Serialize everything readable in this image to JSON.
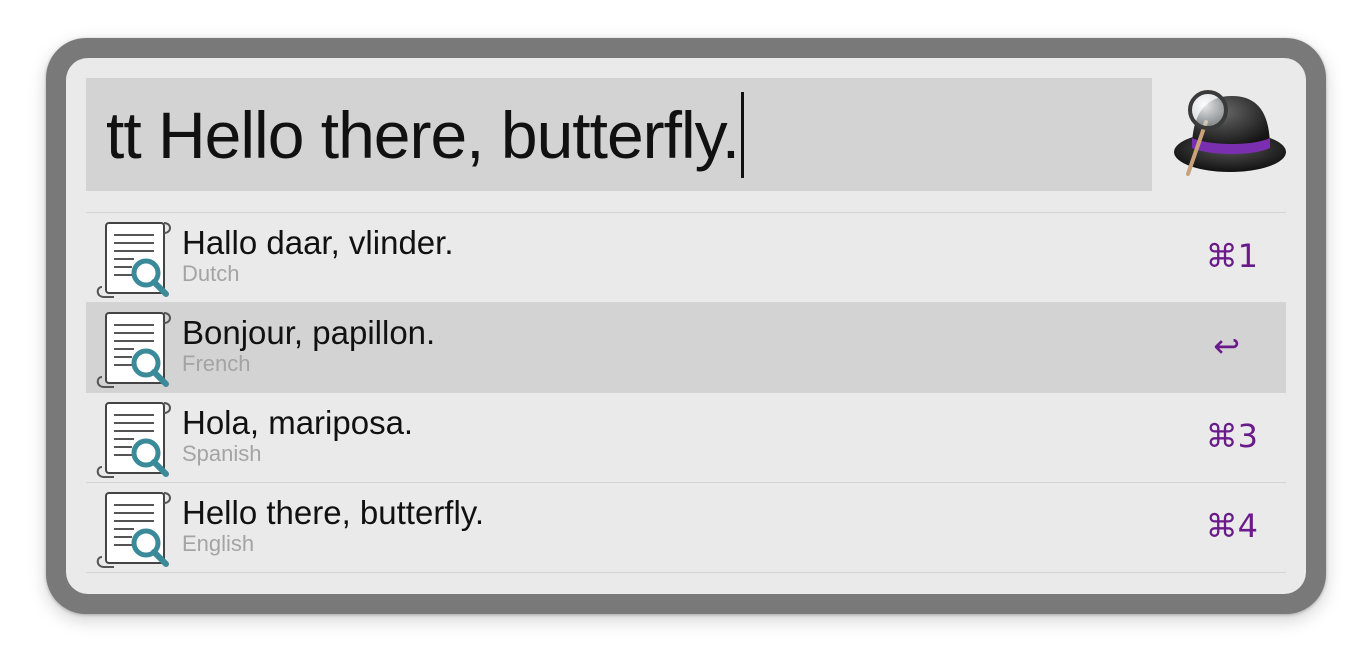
{
  "search": {
    "query": "tt Hello there, butterfly."
  },
  "app_icon": "alfred-hat-icon",
  "accent_color": "#6a1b8a",
  "results": [
    {
      "title": "Hallo daar, vlinder.",
      "subtitle": "Dutch",
      "shortcut": "⌘1",
      "icon": "document-search-icon",
      "selected": false
    },
    {
      "title": "Bonjour, papillon.",
      "subtitle": "French",
      "shortcut": "↩",
      "icon": "document-search-icon",
      "selected": true
    },
    {
      "title": "Hola, mariposa.",
      "subtitle": "Spanish",
      "shortcut": "⌘3",
      "icon": "document-search-icon",
      "selected": false
    },
    {
      "title": "Hello there, butterfly.",
      "subtitle": "English",
      "shortcut": "⌘4",
      "icon": "document-search-icon",
      "selected": false
    }
  ]
}
